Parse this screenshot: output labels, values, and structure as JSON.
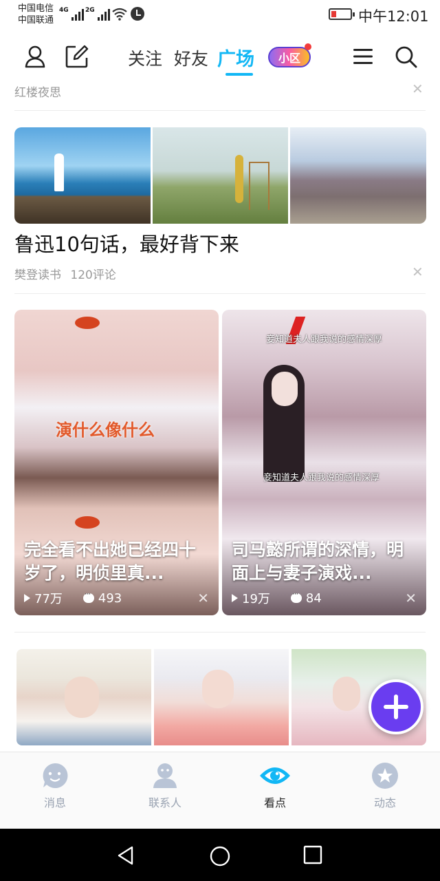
{
  "status_bar": {
    "carrier1": "中国电信",
    "carrier2": "中国联通",
    "net1": "4G",
    "net2": "2G",
    "time": "中午12:01"
  },
  "top_nav": {
    "tabs": [
      "关注",
      "好友",
      "广场"
    ],
    "active_tab": "广场",
    "community_badge": "小区"
  },
  "feed": {
    "item1": {
      "source": "红楼夜思"
    },
    "item2": {
      "title": "鲁迅10句话，最好背下来",
      "source": "樊登读书",
      "comments": "120评论"
    },
    "video1": {
      "overlay": "演什么像什么",
      "title": "完全看不出她已经四十岁了，明侦里真...",
      "plays": "77万",
      "comments": "493"
    },
    "video2": {
      "overlay": "妾知道夫人跟我说的感情深厚",
      "title": "司马懿所谓的深情，明面上与妻子演戏...",
      "plays": "19万",
      "comments": "84"
    }
  },
  "bottom_tabs": [
    {
      "label": "消息",
      "icon": "message-icon"
    },
    {
      "label": "联系人",
      "icon": "contacts-icon"
    },
    {
      "label": "看点",
      "icon": "eye-icon",
      "active": true
    },
    {
      "label": "动态",
      "icon": "star-icon"
    }
  ],
  "colors": {
    "accent": "#12b7f5",
    "fab": "#6a3df0"
  }
}
